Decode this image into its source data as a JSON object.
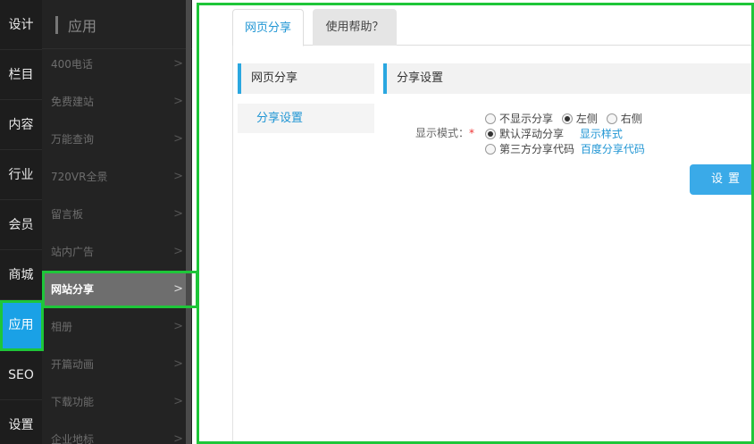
{
  "nav": {
    "items": [
      {
        "label": "设计"
      },
      {
        "label": "栏目"
      },
      {
        "label": "内容"
      },
      {
        "label": "行业"
      },
      {
        "label": "会员"
      },
      {
        "label": "商城"
      },
      {
        "label": "应用",
        "active": true
      },
      {
        "label": "SEO"
      },
      {
        "label": "设置"
      }
    ]
  },
  "apps": {
    "title": "应用",
    "items": [
      {
        "label": "400电话"
      },
      {
        "label": "免费建站"
      },
      {
        "label": "万能查询"
      },
      {
        "label": "720VR全景"
      },
      {
        "label": "留言板"
      },
      {
        "label": "站内广告"
      },
      {
        "label": "网站分享",
        "active": true
      },
      {
        "label": "相册"
      },
      {
        "label": "开篇动画"
      },
      {
        "label": "下载功能"
      },
      {
        "label": "企业地标"
      }
    ],
    "arrow": ">"
  },
  "tabs": {
    "share": "网页分享",
    "help": "使用帮助？"
  },
  "subnav": {
    "head": "网页分享",
    "item": "分享设置"
  },
  "settings": {
    "head": "分享设置",
    "display_mode_label": "显示模式：",
    "required_mark": "*",
    "opt_none": "不显示分享",
    "opt_left": "左侧",
    "opt_right": "右侧",
    "opt_float": "默认浮动分享",
    "link_style": "显示样式",
    "opt_third": "第三方分享代码",
    "link_baidu": "百度分享代码",
    "save": "设置"
  },
  "colors": {
    "accent": "#2aa7e0",
    "active_nav": "#1aa1e6",
    "highlight_frame": "#1ec639"
  }
}
